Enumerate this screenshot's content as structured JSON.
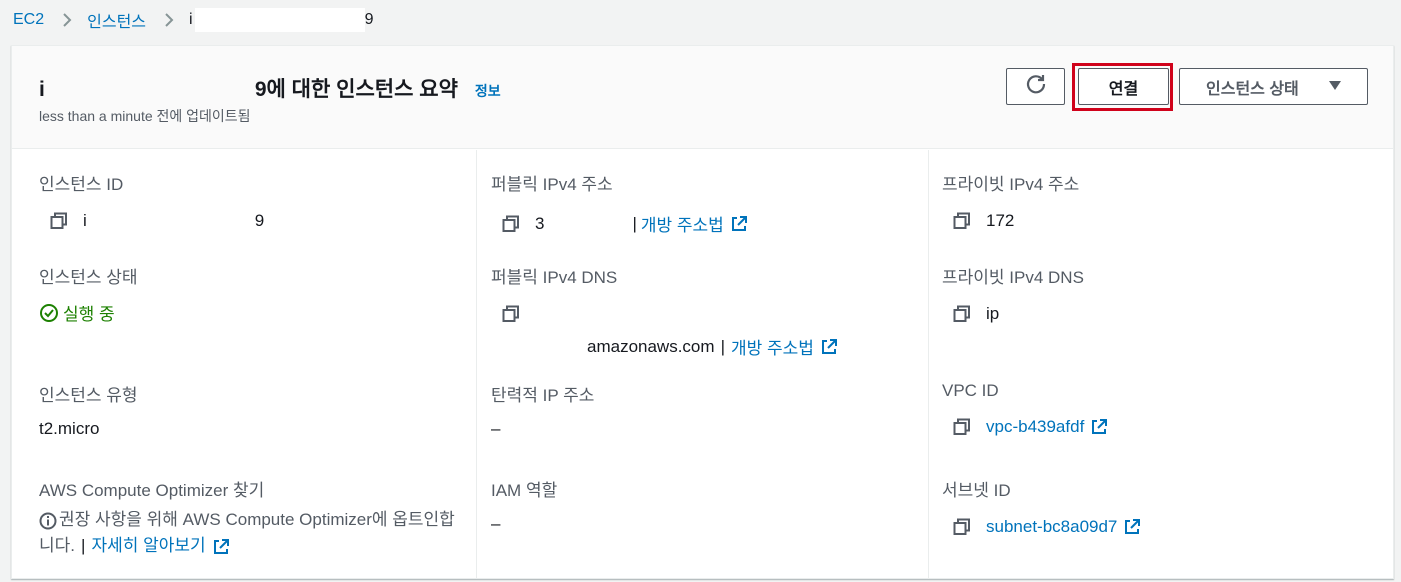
{
  "breadcrumb": {
    "items": [
      "EC2",
      "인스턴스"
    ],
    "current_prefix": "i",
    "current_suffix": "9"
  },
  "header": {
    "title_prefix": "i",
    "title_suffix": "9에 대한 인스턴스 요약",
    "info_link": "정보",
    "subtitle": "less than a minute 전에 업데이트됨",
    "connect_label": "연결",
    "state_label": "인스턴스 상태"
  },
  "details": {
    "instance_id": {
      "label": "인스턴스 ID",
      "prefix": "i",
      "suffix": "9"
    },
    "instance_state": {
      "label": "인스턴스 상태",
      "value": "실행 중"
    },
    "instance_type": {
      "label": "인스턴스 유형",
      "value": "t2.micro"
    },
    "compute_optimizer": {
      "label": "AWS Compute Optimizer 찾기",
      "note": "권장 사항을 위해 AWS Compute Optimizer에 옵트인합니다.",
      "link": "자세히 알아보기"
    },
    "public_ipv4": {
      "label": "퍼블릭 IPv4 주소",
      "value": "3",
      "link": "개방 주소법"
    },
    "public_dns": {
      "label": "퍼블릭 IPv4 DNS",
      "value": "amazonaws.com",
      "link": "개방 주소법"
    },
    "elastic_ip": {
      "label": "탄력적 IP 주소",
      "value": "–"
    },
    "iam_role": {
      "label": "IAM 역할",
      "value": "–"
    },
    "private_ipv4": {
      "label": "프라이빗 IPv4 주소",
      "value": "172"
    },
    "private_dns": {
      "label": "프라이빗 IPv4 DNS",
      "value": "ip"
    },
    "vpc_id": {
      "label": "VPC ID",
      "value": "vpc-b439afdf"
    },
    "subnet_id": {
      "label": "서브넷 ID",
      "value": "subnet-bc8a09d7"
    }
  },
  "colors": {
    "link": "#0073bb",
    "success": "#1d8102",
    "highlight": "#d0021b"
  },
  "icons": [
    "chevron-right-icon",
    "refresh-icon",
    "caret-down-icon",
    "copy-icon",
    "external-link-icon",
    "status-ok-icon",
    "info-icon"
  ]
}
